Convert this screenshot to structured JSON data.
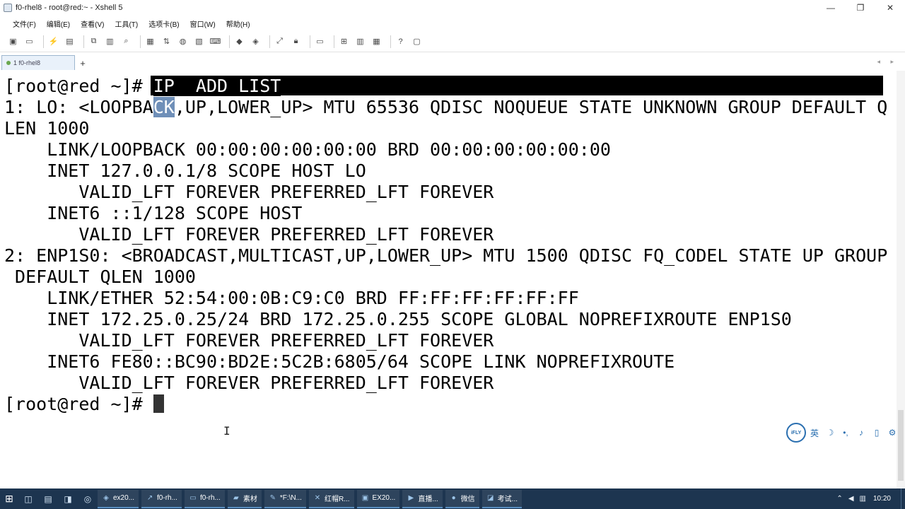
{
  "window": {
    "title": "f0-rhel8 - root@red:~ - Xshell 5",
    "controls": {
      "minimize": "—",
      "maximize": "❐",
      "close": "✕"
    }
  },
  "menu": [
    "文件(F)",
    "编辑(E)",
    "查看(V)",
    "工具(T)",
    "选项卡(B)",
    "窗口(W)",
    "帮助(H)"
  ],
  "toolbar": {
    "icons": [
      "new-session-icon",
      "open-icon",
      "disconnect-icon",
      "properties-icon",
      "copy-icon",
      "paste-icon",
      "find-icon",
      "print-icon",
      "transfer-icon",
      "globe-icon",
      "script-icon",
      "keyboard-icon",
      "compose-icon",
      "fullscreen-icon",
      "lock-icon",
      "keymap-icon",
      "add-icon",
      "layout-icon",
      "help-icon",
      "chat-icon"
    ]
  },
  "tabs": [
    {
      "label": "1 f0-rhel8"
    }
  ],
  "tab_add": "+",
  "tab_nav": "◂ ▸",
  "terminal": {
    "prompt1": "[root@red ~]# ",
    "command": "IP  ADD LIST",
    "line2_pre": "1: LO: <LOOPBA",
    "line2_sel": "CK",
    "line2_post": ",UP,LOWER_UP> MTU 65536 QDISC NOQUEUE STATE UNKNOWN GROUP DEFAULT Q",
    "line3": "LEN 1000",
    "line4": "    LINK/LOOPBACK 00:00:00:00:00:00 BRD 00:00:00:00:00:00",
    "line5": "    INET 127.0.0.1/8 SCOPE HOST LO",
    "line6": "       VALID_LFT FOREVER PREFERRED_LFT FOREVER",
    "line7": "    INET6 ::1/128 SCOPE HOST",
    "line8": "       VALID_LFT FOREVER PREFERRED_LFT FOREVER",
    "line9": "2: ENP1S0: <BROADCAST,MULTICAST,UP,LOWER_UP> MTU 1500 QDISC FQ_CODEL STATE UP GROUP",
    "line10": " DEFAULT QLEN 1000",
    "line11": "    LINK/ETHER 52:54:00:0B:C9:C0 BRD FF:FF:FF:FF:FF:FF",
    "line12": "    INET 172.25.0.25/24 BRD 172.25.0.255 SCOPE GLOBAL NOPREFIXROUTE ENP1S0",
    "line13": "       VALID_LFT FOREVER PREFERRED_LFT FOREVER",
    "line14": "    INET6 FE80::BC90:BD2E:5C2B:6805/64 SCOPE LINK NOPREFIXROUTE",
    "line15": "       VALID_LFT FOREVER PREFERRED_LFT FOREVER",
    "prompt2": "[root@red ~]# "
  },
  "ime": {
    "logo": "iFLY",
    "lang": "英",
    "buttons": [
      "moon-icon",
      "punctuation-icon",
      "mic-icon",
      "file-icon",
      "settings-icon"
    ],
    "moon": "☽",
    "punct": "•,",
    "mic": "🎤",
    "file": "▯",
    "settings": "⚙"
  },
  "taskbar": {
    "tasks": [
      {
        "label": "ex20..."
      },
      {
        "label": "f0-rh..."
      },
      {
        "label": "f0-rh..."
      },
      {
        "label": "素材"
      },
      {
        "label": "*F:\\N..."
      },
      {
        "label": "红帽R..."
      },
      {
        "label": "EX20..."
      },
      {
        "label": "直播..."
      },
      {
        "label": "微信"
      },
      {
        "label": "考试..."
      }
    ],
    "clock": "10:20"
  }
}
